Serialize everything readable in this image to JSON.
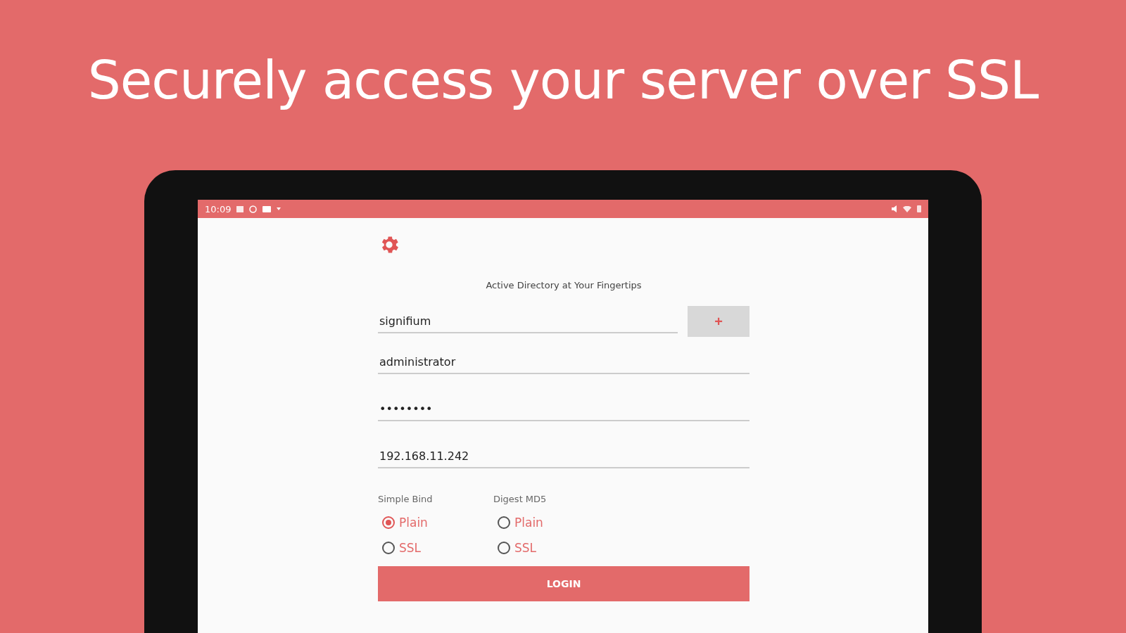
{
  "headline": "Securely access your server over SSL",
  "status_bar": {
    "time": "10:09"
  },
  "app": {
    "subtitle": "Active Directory at Your Fingertips",
    "domain_field": {
      "value": "signifium"
    },
    "add_button": {
      "label": "+"
    },
    "fields": [
      {
        "kind": "text",
        "value": "administrator"
      },
      {
        "kind": "password",
        "value": "••••••••"
      },
      {
        "kind": "text",
        "value": "192.168.11.242"
      }
    ],
    "radio_groups": [
      {
        "label": "Simple Bind",
        "options": [
          {
            "label": "Plain",
            "selected": true
          },
          {
            "label": "SSL",
            "selected": false
          }
        ]
      },
      {
        "label": "Digest MD5",
        "options": [
          {
            "label": "Plain",
            "selected": false
          },
          {
            "label": "SSL",
            "selected": false
          }
        ]
      }
    ],
    "login_button": {
      "label": "LOGIN"
    }
  }
}
